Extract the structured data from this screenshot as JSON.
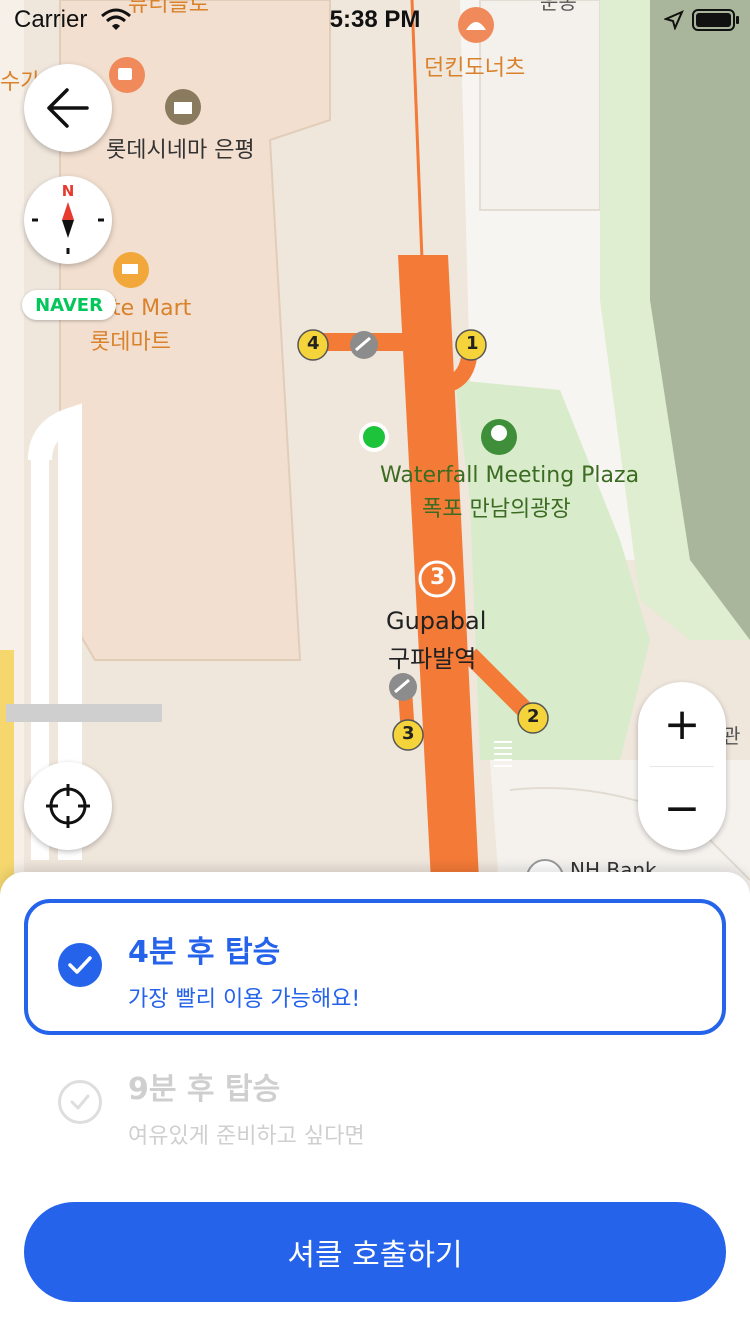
{
  "status_bar": {
    "carrier": "Carrier",
    "time": "5:38 PM"
  },
  "map": {
    "labels": {
      "poi_top_left_partial": "수가",
      "poi_top_partial": "뷰티플로",
      "lotte_cinema": "롯데시네마 은평",
      "dunkin": "던킨도너츠",
      "lotte_mart_en": "te Mart",
      "lotte_mart_ko": "롯데마트",
      "plaza_en": "Waterfall Meeting Plaza",
      "plaza_ko": "폭포 만남의광장",
      "station_en": "Gupabal",
      "station_ko": "구파발역",
      "station_line": "3",
      "nh_bank": "NH Bank",
      "right_partial": "관",
      "top_right_partial": "운동"
    },
    "exits": [
      "1",
      "2",
      "3",
      "4"
    ],
    "naver_logo": "NAVER",
    "compass_letter": "N",
    "colors": {
      "subway_line": "#f47a37",
      "park": "#d8eccb",
      "current_location": "#1ec33c",
      "label_orange": "#d9822b",
      "label_green": "#3c6b22"
    }
  },
  "controls": {
    "back_icon": "arrow-left-icon",
    "compass_icon": "compass-icon",
    "locate_icon": "crosshair-icon",
    "zoom_in": "+",
    "zoom_out": "−"
  },
  "options": [
    {
      "title": "4분 후 탑승",
      "subtitle": "가장 빨리 이용 가능해요!",
      "selected": true
    },
    {
      "title": "9분 후 탑승",
      "subtitle": "여유있게 준비하고 싶다면",
      "selected": false
    }
  ],
  "call_button": "셔클 호출하기",
  "theme": {
    "primary": "#2563eb",
    "disabled": "#cfcfcf"
  }
}
